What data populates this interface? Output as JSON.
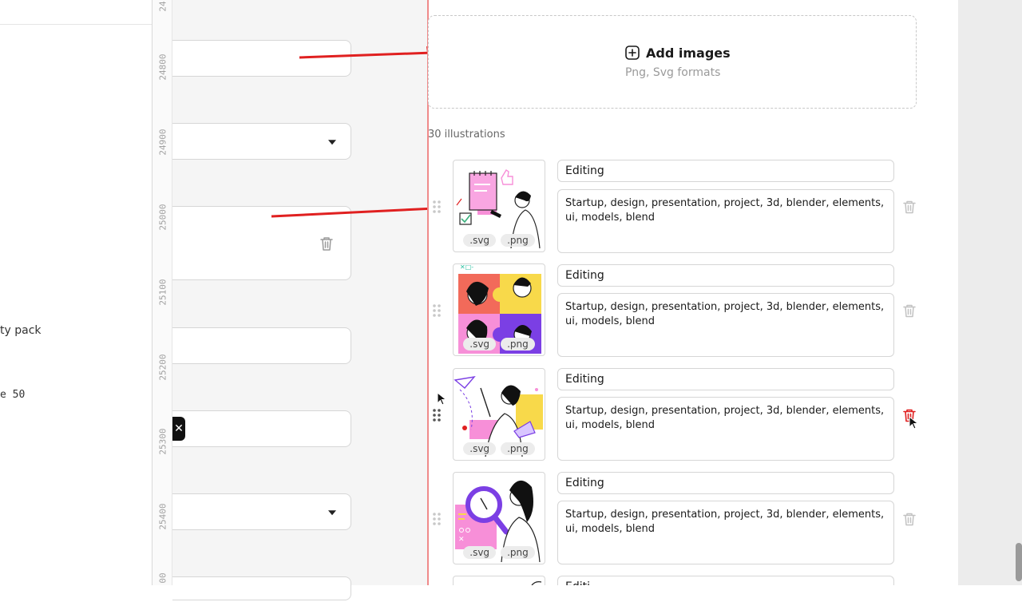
{
  "left_panel": {
    "texts": [
      "ty pack"
    ],
    "mono_texts": [
      "e 50"
    ]
  },
  "ruler": {
    "labels": [
      "24",
      "24800",
      "24900",
      "25000",
      "25100",
      "25200",
      "25300",
      "25400",
      "00"
    ]
  },
  "upload": {
    "label": "Add images",
    "formats": "Png, Svg formats",
    "icon": "plus-square-icon"
  },
  "illustrations": {
    "count_label": "30 illustrations",
    "items": [
      {
        "title": "Editing",
        "tags": "Startup, design, presentation, project, 3d, blender, elements, ui, models, blend",
        "formats": [
          ".svg",
          ".png"
        ]
      },
      {
        "title": "Editing",
        "tags": "Startup, design, presentation, project, 3d, blender, elements, ui, models, blend",
        "formats": [
          ".svg",
          ".png"
        ]
      },
      {
        "title": "Editing",
        "tags": "Startup, design, presentation, project, 3d, blender, elements, ui, models, blend",
        "formats": [
          ".svg",
          ".png"
        ]
      },
      {
        "title": "Editing",
        "tags": "Startup, design, presentation, project, 3d, blender, elements, ui, models, blend",
        "formats": [
          ".svg",
          ".png"
        ]
      },
      {
        "title": "Editi"
      }
    ]
  },
  "colors": {
    "accent_red": "#e02020",
    "guide_line": "#f08a8a",
    "pink": "#f78fd8",
    "yellow": "#f8d94a",
    "purple": "#7b3fe4"
  }
}
